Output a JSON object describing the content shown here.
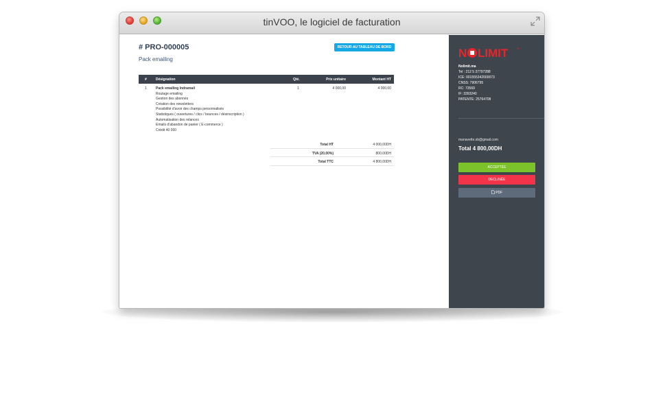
{
  "window": {
    "title": "tinVOO, le logiciel de facturation"
  },
  "document": {
    "number": "# PRO-000005",
    "subject": "Pack emailing",
    "back_button": "RETOUR AU TABLEAU DE BORD"
  },
  "table": {
    "headers": {
      "num": "#",
      "designation": "Désignation",
      "qty": "Qté.",
      "unit_price": "Prix unitaire",
      "amount": "Montant HT"
    },
    "rows": [
      {
        "num": "1",
        "lines": [
          "Pack emailing Indramail",
          "Routage emailing",
          "Gestion des abonnés",
          "Création des newsletters",
          "Possibilité d'avoir des champs personnalisés",
          "Statistiques ( ouvertures / clics / bounces / désinscription )",
          "Automatisation des relances",
          "Emails d'abandon de panier ( E-commerce )",
          "Crédit 40 000"
        ],
        "qty": "1",
        "unit_price": "4 000,00",
        "amount": "4 000,00"
      }
    ]
  },
  "totals": {
    "ht_label": "Total HT",
    "ht_value": "4 000,00DH",
    "tva_label": "TVA (20,00%)",
    "tva_value": "800,00DH",
    "ttc_label": "Total TTC",
    "ttc_value": "4 800,00DH"
  },
  "sidebar": {
    "logo_text": "NOLIMIT",
    "company": {
      "name": "Nolimit.ma",
      "tel": "Tel : 212 5 37797288",
      "ice": "ICE: 001555342000073",
      "cnss": "CNSS: 7906795",
      "rc": "RC: 73569",
      "if": "IF: 3393240",
      "patente": "PATENTE: 25764708"
    },
    "email": "manavette.sb@gmail.com",
    "total": "Total 4 800,00DH",
    "buttons": {
      "accept": "ACCEPTÉE",
      "decline": "DECLINÉE",
      "pdf": "PDF"
    }
  },
  "colors": {
    "sidebar_bg": "#3f454d",
    "accept": "#7cc22a",
    "decline": "#f2334a",
    "pdf": "#5e6b7a",
    "back_button": "#15a8e6",
    "logo_red": "#e3262c"
  }
}
